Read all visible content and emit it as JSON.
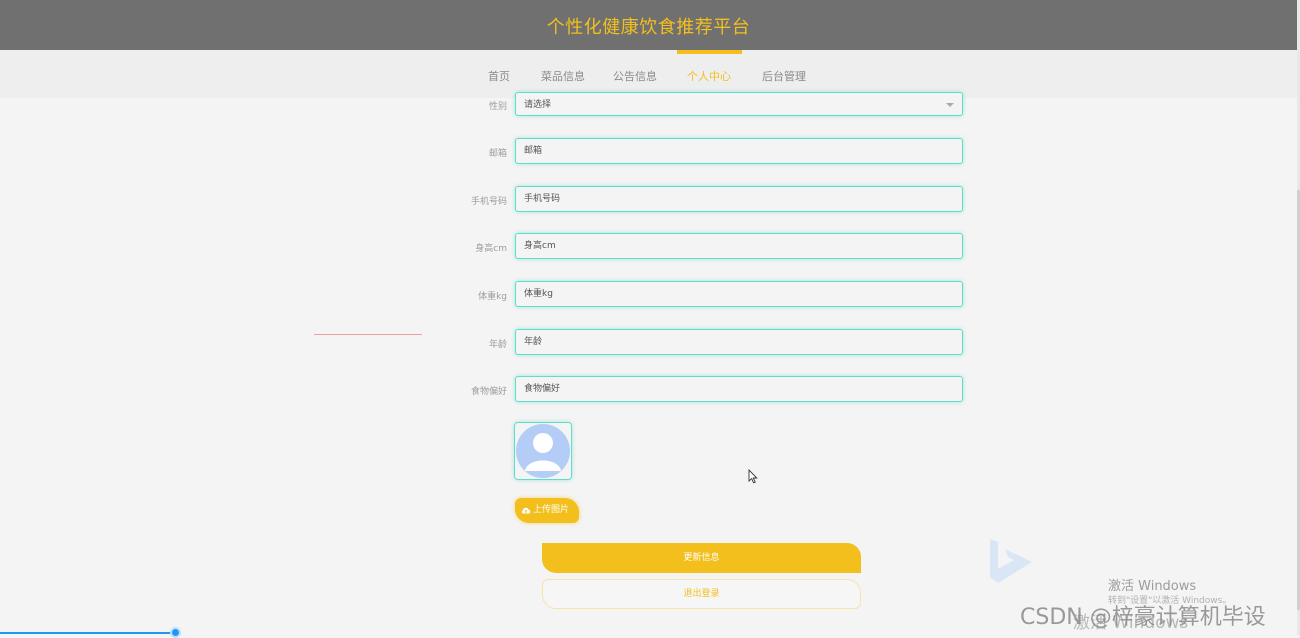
{
  "header": {
    "title": "个性化健康饮食推荐平台"
  },
  "nav": {
    "items": [
      {
        "label": "首页"
      },
      {
        "label": "菜品信息"
      },
      {
        "label": "公告信息"
      },
      {
        "label": "个人中心",
        "active": true
      },
      {
        "label": "后台管理"
      }
    ]
  },
  "form": {
    "gender": {
      "label": "性别",
      "value": "请选择"
    },
    "email": {
      "label": "邮箱",
      "placeholder": "邮箱"
    },
    "phone": {
      "label": "手机号码",
      "placeholder": "手机号码"
    },
    "height": {
      "label": "身高cm",
      "placeholder": "身高cm"
    },
    "weight": {
      "label": "体重kg",
      "placeholder": "体重kg"
    },
    "age": {
      "label": "年龄",
      "placeholder": "年龄"
    },
    "preference": {
      "label": "食物偏好",
      "placeholder": "食物偏好"
    }
  },
  "avatar": {
    "icon": "user-avatar-icon"
  },
  "buttons": {
    "upload": "上传图片",
    "update": "更新信息",
    "logout": "退出登录"
  },
  "windows_activation": {
    "title": "激活 Windows",
    "subtitle": "转到\"设置\"以激活 Windows。",
    "ghost": "激活 Windows"
  },
  "watermark": "CSDN @梓豪计算机毕设",
  "colors": {
    "accent": "#f2bf1d",
    "input_border": "#5fdccb",
    "header_bg": "#707070"
  }
}
